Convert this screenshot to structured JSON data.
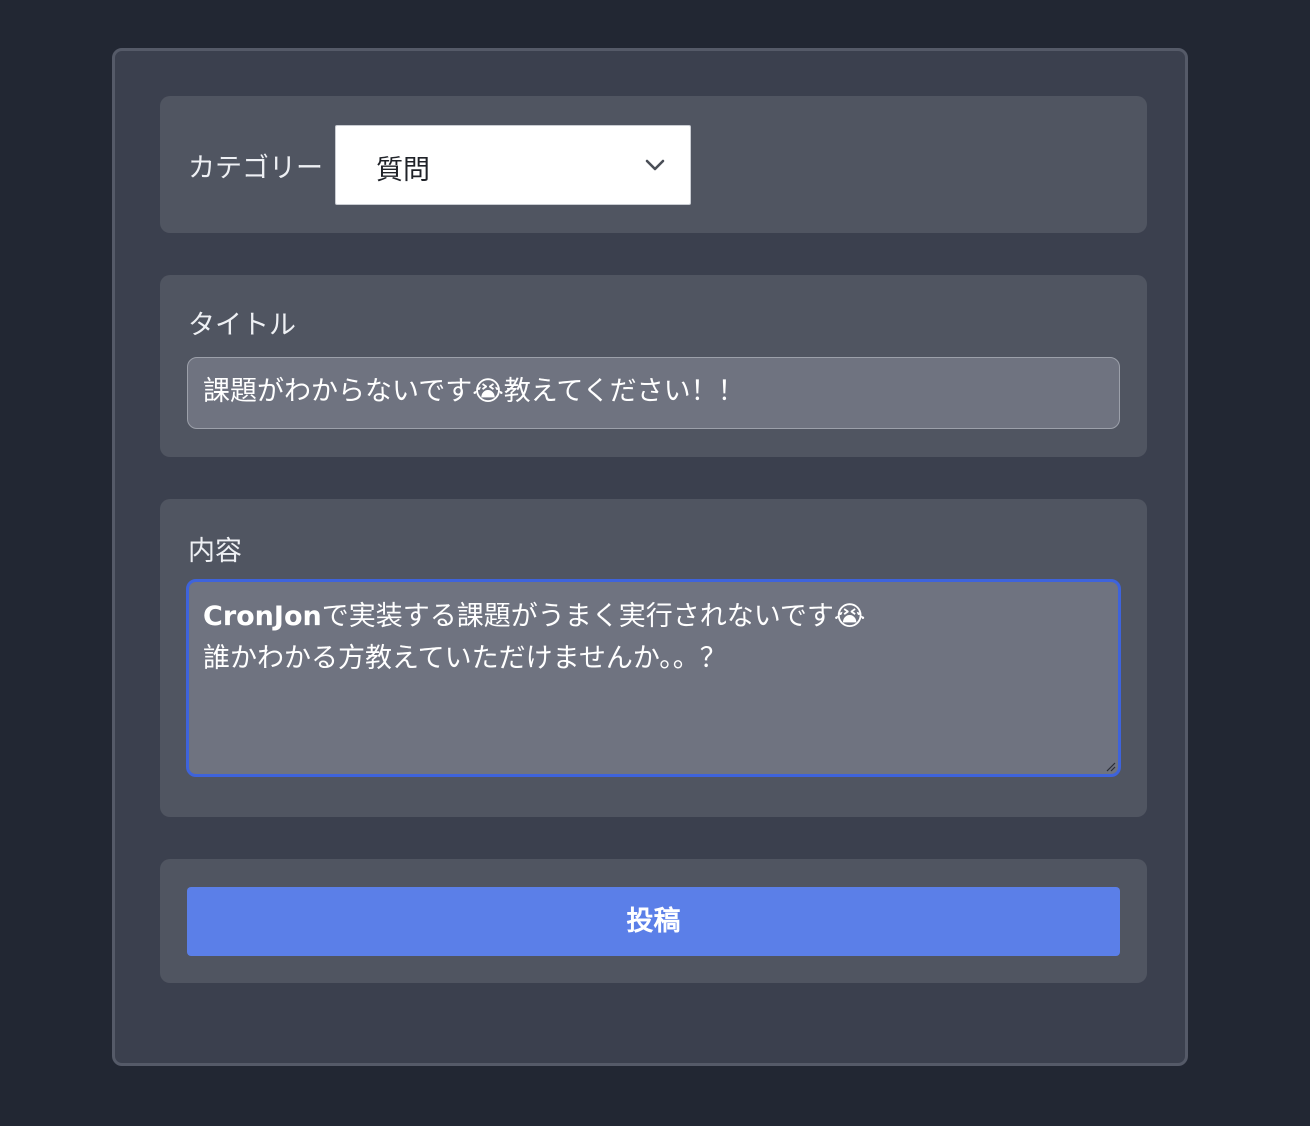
{
  "category": {
    "label": "カテゴリー",
    "selected": "質問",
    "icon": "chevron-down-icon"
  },
  "title_field": {
    "label": "タイトル",
    "value": "課題がわからないです😭教えてください！！"
  },
  "content_field": {
    "label": "内容",
    "line1_bold": "CronJon",
    "line1_rest": "で実装する課題がうまく実行されないです😭",
    "line2": "誰かわかる方教えていただけませんか。。？"
  },
  "submit": {
    "label": "投稿",
    "color": "#5b7fe8"
  },
  "colors": {
    "page_bg": "#222733",
    "card_bg": "#3b404e",
    "section_bg": "#505561",
    "input_bg": "#6f7380",
    "focus_border": "#3e63db"
  }
}
